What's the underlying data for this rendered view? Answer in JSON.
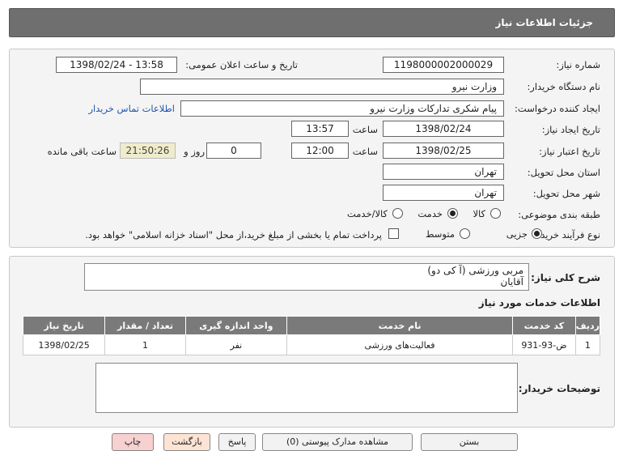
{
  "header": {
    "title": "جزئیات اطلاعات نیاز"
  },
  "form": {
    "need_number": {
      "label": "شماره نیاز:",
      "value": "1198000002000029"
    },
    "announce": {
      "label": "تاریخ و ساعت اعلان عمومی:",
      "value": "1398/02/24 - 13:58"
    },
    "buyer_org": {
      "label": "نام دستگاه خریدار:",
      "value": "وزارت نیرو"
    },
    "requester": {
      "label": "ایجاد کننده درخواست:",
      "value": "پیام شکری تدارکات وزارت نیرو",
      "contact_link": "اطلاعات تماس خریدار"
    },
    "created": {
      "label": "تاریخ ایجاد نیاز:",
      "date": "1398/02/24",
      "time_label": "ساعت",
      "time": "13:57"
    },
    "validity": {
      "label": "تاریخ اعتبار نیاز:",
      "date": "1398/02/25",
      "time_label": "ساعت",
      "time": "12:00",
      "days": "0",
      "days_label": "روز و",
      "remaining": "21:50:26",
      "remaining_label": "ساعت باقی مانده"
    },
    "province": {
      "label": "استان محل تحویل:",
      "value": "تهران"
    },
    "city": {
      "label": "شهر محل تحویل:",
      "value": "تهران"
    },
    "category": {
      "label": "طبقه بندی موضوعی:",
      "options": [
        "کالا",
        "خدمت",
        "کالا/خدمت"
      ],
      "selected": "خدمت"
    },
    "process": {
      "label": "نوع فرآیند خرید :",
      "options": [
        "جزیی",
        "متوسط"
      ],
      "selected": "جزیی",
      "note": "پرداخت تمام یا بخشی از مبلغ خرید،از محل \"اسناد خزانه اسلامی\" خواهد بود."
    }
  },
  "summary": {
    "label": "شرح کلی نیاز:",
    "line1": "مربی ورزشی (آ کی دو)",
    "line2": "آقایان"
  },
  "services": {
    "title": "اطلاعات خدمات مورد نیاز",
    "columns": [
      "ردیف",
      "کد خدمت",
      "نام خدمت",
      "واحد اندازه گیری",
      "تعداد / مقدار",
      "تاریخ نیاز"
    ],
    "rows": [
      {
        "row": "1",
        "code": "ض-93-931",
        "name": "فعالیت‌های ورزشی",
        "unit": "نفر",
        "qty": "1",
        "date": "1398/02/25"
      }
    ]
  },
  "buyer_notes": {
    "label": "توضیحات خریدار:"
  },
  "buttons": {
    "print": "چاپ",
    "back": "بازگشت",
    "view_docs": "مشاهده مدارک پیوستی (0)",
    "reply": "پاسخ",
    "close": "بستن"
  }
}
